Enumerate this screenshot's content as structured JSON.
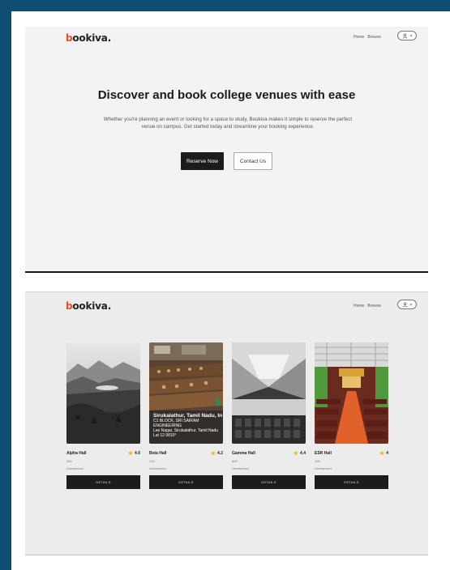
{
  "landing": {
    "logo": {
      "first": "b",
      "rest": "ookiva."
    },
    "nav": {
      "home": "Home",
      "browse": "Browse"
    },
    "hero": {
      "title": "Discover and book college venues with ease",
      "description": "Whether you're planning an event or looking for a space to study, Bookiva makes it simple to reserve the perfect venue on campus. Get started today and streamline your booking experience."
    },
    "buttons": {
      "reserve": "Reserve Now",
      "contact": "Contact Us"
    }
  },
  "browse": {
    "logo": {
      "first": "b",
      "rest": "ookiva."
    },
    "nav": {
      "home": "Home",
      "browse": "Browse"
    },
    "venues": [
      {
        "name": "Alpha Hall",
        "rating": "4.6",
        "capacity": "200",
        "status": "Unreserved",
        "button": "DETAILS"
      },
      {
        "name": "Beta Hall",
        "rating": "4.2",
        "capacity": "120",
        "status": "Unreserved",
        "button": "DETAILS",
        "overlay": {
          "location": "Sirukalathur, Tamil Nadu, In",
          "line1": "C1 BLOCK, SRI SAIRAM ENGINEERING",
          "line2": "Lee Nagar, Sirukalathur, Tamil Nadu",
          "line3": "Lat 12.9810°"
        }
      },
      {
        "name": "Gamma Hall",
        "rating": "4.4",
        "capacity": "500",
        "status": "Unreserved",
        "button": "DETAILS"
      },
      {
        "name": "ESR Hall",
        "rating": "4",
        "capacity": "100",
        "status": "Unreserved",
        "button": "DETAILS"
      }
    ]
  },
  "icons": {
    "user": "user-icon",
    "chevron": "chevron-down-icon",
    "star": "star-icon"
  },
  "colors": {
    "frame": "#0f4e73",
    "accent": "#e24d2c",
    "button_dark": "#1c1c1c",
    "star": "#f2b705"
  }
}
